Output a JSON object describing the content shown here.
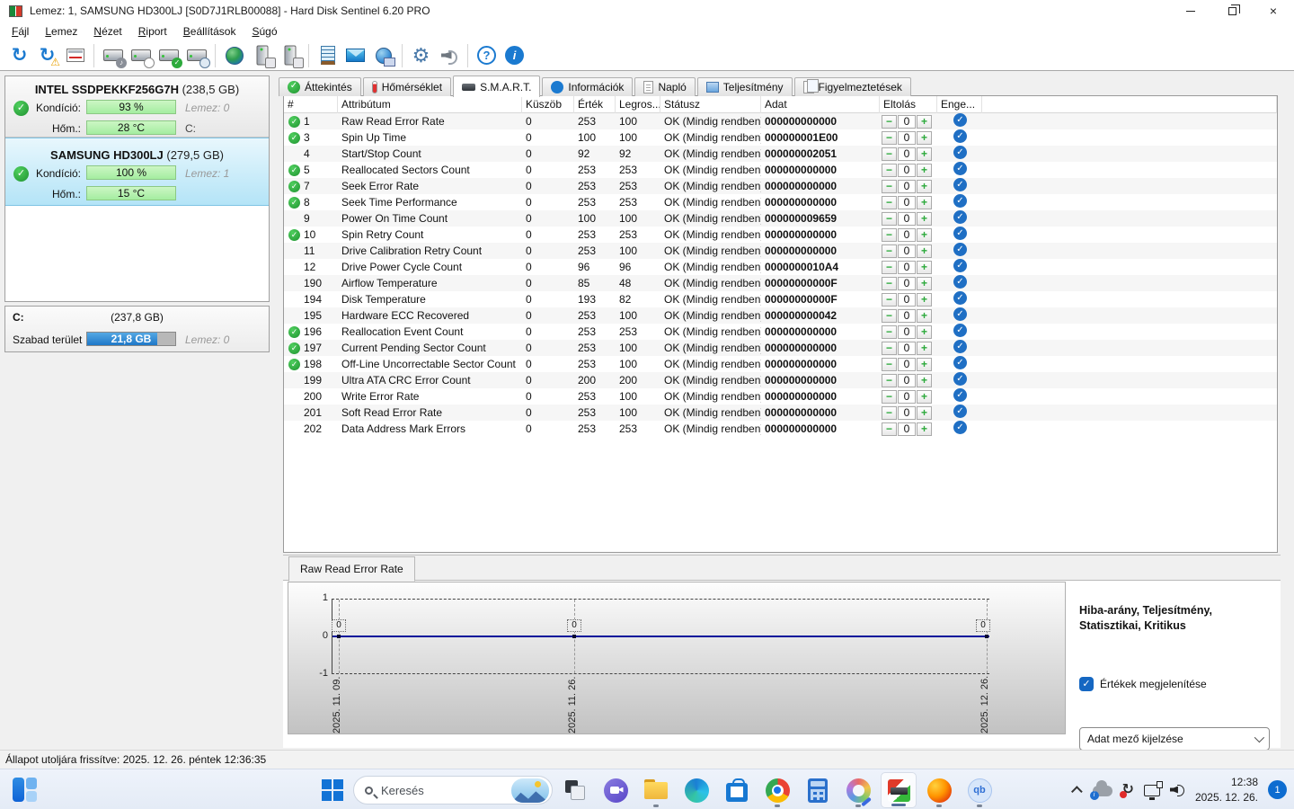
{
  "window": {
    "title": "Lemez: 1, SAMSUNG HD300LJ [S0D7J1RLB00088]  -  Hard Disk Sentinel 6.20 PRO",
    "controls": [
      "minimize",
      "restore",
      "close"
    ]
  },
  "menu": [
    "Fájl",
    "Lemez",
    "Nézet",
    "Riport",
    "Beállítások",
    "Súgó"
  ],
  "toolbar_icons": [
    "refresh",
    "refresh-warning",
    "report-window",
    "disk-sound",
    "disk-clock",
    "disk-test",
    "disk-search",
    "network-disk",
    "disk-connect",
    "disk-remove",
    "notes",
    "email",
    "network-status",
    "settings-gear",
    "sound",
    "help",
    "info"
  ],
  "sidebar": {
    "labels": {
      "condition": "Kondíció:",
      "temperature": "Hőm.:"
    },
    "disks": [
      {
        "name": "INTEL SSDPEKKF256G7H",
        "size": "(238,5 GB)",
        "condition": "93 %",
        "temperature": "28 °C",
        "disk_label": "Lemez: 0",
        "drive": "C:",
        "selected": false
      },
      {
        "name": "SAMSUNG HD300LJ",
        "size": "(279,5 GB)",
        "condition": "100 %",
        "temperature": "15 °C",
        "disk_label": "Lemez: 1",
        "drive": "",
        "selected": true
      }
    ],
    "partition": {
      "name": "C:",
      "size": "(237,8 GB)",
      "free_label": "Szabad terület",
      "free_value": "21,8 GB",
      "free_fill_percent": 80,
      "disk_label": "Lemez: 0"
    }
  },
  "tabs": [
    {
      "label": "Áttekintés",
      "icon": "check",
      "active": false
    },
    {
      "label": "Hőmérséklet",
      "icon": "thermometer",
      "active": false
    },
    {
      "label": "S.M.A.R.T.",
      "icon": "disk",
      "active": true
    },
    {
      "label": "Információk",
      "icon": "info",
      "active": false
    },
    {
      "label": "Napló",
      "icon": "document",
      "active": false
    },
    {
      "label": "Teljesítmény",
      "icon": "chart",
      "active": false
    },
    {
      "label": "Figyelmeztetések",
      "icon": "pages",
      "active": false
    }
  ],
  "smart_table": {
    "columns": [
      "#",
      "Attribútum",
      "Küszöb",
      "Érték",
      "Legros...",
      "Státusz",
      "Adat",
      "Eltolás",
      "Enge..."
    ],
    "rows": [
      {
        "id": "1",
        "flag": true,
        "name": "Raw Read Error Rate",
        "threshold": "0",
        "value": "253",
        "worst": "100",
        "status": "OK (Mindig rendben)",
        "data": "000000000000",
        "offset": "0"
      },
      {
        "id": "3",
        "flag": true,
        "name": "Spin Up Time",
        "threshold": "0",
        "value": "100",
        "worst": "100",
        "status": "OK (Mindig rendben)",
        "data": "000000001E00",
        "offset": "0"
      },
      {
        "id": "4",
        "flag": false,
        "name": "Start/Stop Count",
        "threshold": "0",
        "value": "92",
        "worst": "92",
        "status": "OK (Mindig rendben)",
        "data": "000000002051",
        "offset": "0"
      },
      {
        "id": "5",
        "flag": true,
        "name": "Reallocated Sectors Count",
        "threshold": "0",
        "value": "253",
        "worst": "253",
        "status": "OK (Mindig rendben)",
        "data": "000000000000",
        "offset": "0"
      },
      {
        "id": "7",
        "flag": true,
        "name": "Seek Error Rate",
        "threshold": "0",
        "value": "253",
        "worst": "253",
        "status": "OK (Mindig rendben)",
        "data": "000000000000",
        "offset": "0"
      },
      {
        "id": "8",
        "flag": true,
        "name": "Seek Time Performance",
        "threshold": "0",
        "value": "253",
        "worst": "253",
        "status": "OK (Mindig rendben)",
        "data": "000000000000",
        "offset": "0"
      },
      {
        "id": "9",
        "flag": false,
        "name": "Power On Time Count",
        "threshold": "0",
        "value": "100",
        "worst": "100",
        "status": "OK (Mindig rendben)",
        "data": "000000009659",
        "offset": "0"
      },
      {
        "id": "10",
        "flag": true,
        "name": "Spin Retry Count",
        "threshold": "0",
        "value": "253",
        "worst": "253",
        "status": "OK (Mindig rendben)",
        "data": "000000000000",
        "offset": "0"
      },
      {
        "id": "11",
        "flag": false,
        "name": "Drive Calibration Retry Count",
        "threshold": "0",
        "value": "253",
        "worst": "100",
        "status": "OK (Mindig rendben)",
        "data": "000000000000",
        "offset": "0"
      },
      {
        "id": "12",
        "flag": false,
        "name": "Drive Power Cycle Count",
        "threshold": "0",
        "value": "96",
        "worst": "96",
        "status": "OK (Mindig rendben)",
        "data": "0000000010A4",
        "offset": "0"
      },
      {
        "id": "190",
        "flag": false,
        "name": "Airflow Temperature",
        "threshold": "0",
        "value": "85",
        "worst": "48",
        "status": "OK (Mindig rendben)",
        "data": "00000000000F",
        "offset": "0"
      },
      {
        "id": "194",
        "flag": false,
        "name": "Disk Temperature",
        "threshold": "0",
        "value": "193",
        "worst": "82",
        "status": "OK (Mindig rendben)",
        "data": "00000000000F",
        "offset": "0"
      },
      {
        "id": "195",
        "flag": false,
        "name": "Hardware ECC Recovered",
        "threshold": "0",
        "value": "253",
        "worst": "100",
        "status": "OK (Mindig rendben)",
        "data": "000000000042",
        "offset": "0"
      },
      {
        "id": "196",
        "flag": true,
        "name": "Reallocation Event Count",
        "threshold": "0",
        "value": "253",
        "worst": "253",
        "status": "OK (Mindig rendben)",
        "data": "000000000000",
        "offset": "0"
      },
      {
        "id": "197",
        "flag": true,
        "name": "Current Pending Sector Count",
        "threshold": "0",
        "value": "253",
        "worst": "100",
        "status": "OK (Mindig rendben)",
        "data": "000000000000",
        "offset": "0"
      },
      {
        "id": "198",
        "flag": true,
        "name": "Off-Line Uncorrectable Sector Count",
        "threshold": "0",
        "value": "253",
        "worst": "100",
        "status": "OK (Mindig rendben)",
        "data": "000000000000",
        "offset": "0"
      },
      {
        "id": "199",
        "flag": false,
        "name": "Ultra ATA CRC Error Count",
        "threshold": "0",
        "value": "200",
        "worst": "200",
        "status": "OK (Mindig rendben)",
        "data": "000000000000",
        "offset": "0"
      },
      {
        "id": "200",
        "flag": false,
        "name": "Write Error Rate",
        "threshold": "0",
        "value": "253",
        "worst": "100",
        "status": "OK (Mindig rendben)",
        "data": "000000000000",
        "offset": "0"
      },
      {
        "id": "201",
        "flag": false,
        "name": "Soft Read Error Rate",
        "threshold": "0",
        "value": "253",
        "worst": "100",
        "status": "OK (Mindig rendben)",
        "data": "000000000000",
        "offset": "0"
      },
      {
        "id": "202",
        "flag": false,
        "name": "Data Address Mark Errors",
        "threshold": "0",
        "value": "253",
        "worst": "253",
        "status": "OK (Mindig rendben)",
        "data": "000000000000",
        "offset": "0"
      }
    ]
  },
  "chart_panel": {
    "tab_label": "Raw Read Error Rate",
    "legend_title": "Hiba-arány, Teljesítmény, Statisztikai, Kritikus",
    "show_values_label": "Értékek megjelenítése",
    "show_values_checked": true,
    "field_select_label": "Adat mező kijelzése"
  },
  "chart_data": {
    "type": "line",
    "title": "Raw Read Error Rate",
    "x": [
      "2025. 11. 09.",
      "2025. 11. 26.",
      "2025. 12. 26."
    ],
    "values": [
      0,
      0,
      0
    ],
    "point_labels": [
      "0",
      "0",
      "0"
    ],
    "x_fractions": [
      0.01,
      0.368,
      0.995
    ],
    "ylim": [
      -1,
      1
    ],
    "yticks": [
      "1",
      "0",
      "-1"
    ],
    "line_color": "#00129b",
    "grid": "dashed",
    "legend_position": "right"
  },
  "statusbar": {
    "text": "Állapot utoljára frissítve: 2025. 12. 26. péntek 12:36:35"
  },
  "taskbar": {
    "search_placeholder": "Keresés",
    "apps": [
      "widgets",
      "start",
      "search",
      "task-view",
      "chat",
      "file-explorer",
      "edge",
      "store",
      "chrome",
      "calculator",
      "paint",
      "hard-disk-sentinel",
      "firefox",
      "qbittorrent"
    ],
    "active_app": "hard-disk-sentinel",
    "qb_icon_text": "qb",
    "tray_time": "12:38",
    "tray_date": "2025. 12. 26.",
    "notification_count": "1"
  },
  "colors": {
    "accent_blue": "#1f6fc4",
    "ok_green": "#2daa3c",
    "condition_bar_green": "#b4f0a8",
    "free_bar_blue": "#2f86d2",
    "selected_disk_bg": "#cdeaf8",
    "chart_line": "#00129b"
  }
}
